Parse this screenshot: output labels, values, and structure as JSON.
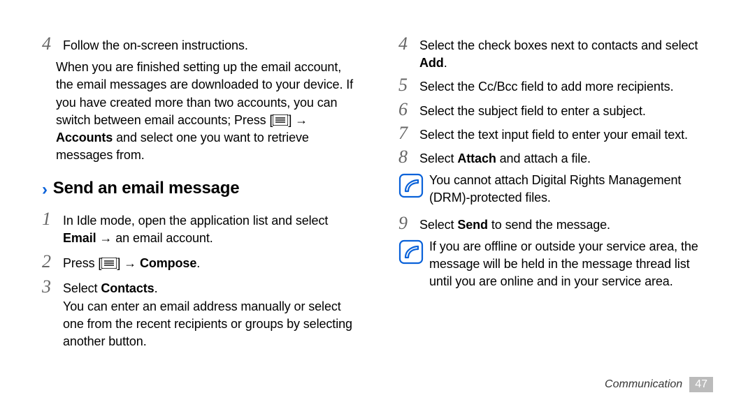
{
  "left": {
    "step4": "Follow the on-screen instructions.",
    "after4_a": "When you are finished setting up the email account, the email messages are downloaded to your device. If you have created more than two accounts, you can switch between email accounts; Press [",
    "after4_b": "] → ",
    "after4_bold": "Accounts",
    "after4_c": " and select one you want to retrieve messages from.",
    "heading": "Send an email message",
    "s1_a": "In Idle mode, open the application list and select ",
    "s1_bold": "Email",
    "s1_b": " → an email account.",
    "s2_a": "Press [",
    "s2_b": "] → ",
    "s2_bold": "Compose",
    "s2_c": ".",
    "s3_a": "Select ",
    "s3_bold": "Contacts",
    "s3_b": ".",
    "s3_para": "You can enter an email address manually or select one from the recent recipients or groups by selecting another button."
  },
  "right": {
    "s4_a": "Select the check boxes next to contacts and select ",
    "s4_bold": "Add",
    "s4_b": ".",
    "s5": "Select the Cc/Bcc field to add more recipients.",
    "s6": "Select the subject field to enter a subject.",
    "s7": "Select the text input field to enter your email text.",
    "s8_a": "Select ",
    "s8_bold": "Attach",
    "s8_b": " and attach a file.",
    "note1": "You cannot attach Digital Rights Management (DRM)-protected files.",
    "s9_a": "Select ",
    "s9_bold": "Send",
    "s9_b": " to send the message.",
    "note2": "If you are offline or outside your service area, the message will be held in the message thread list until you are online and in your service area."
  },
  "footer": {
    "section": "Communication",
    "page": "47"
  },
  "nums": {
    "n1": "1",
    "n2": "2",
    "n3": "3",
    "n4": "4",
    "n5": "5",
    "n6": "6",
    "n7": "7",
    "n8": "8",
    "n9": "9"
  }
}
